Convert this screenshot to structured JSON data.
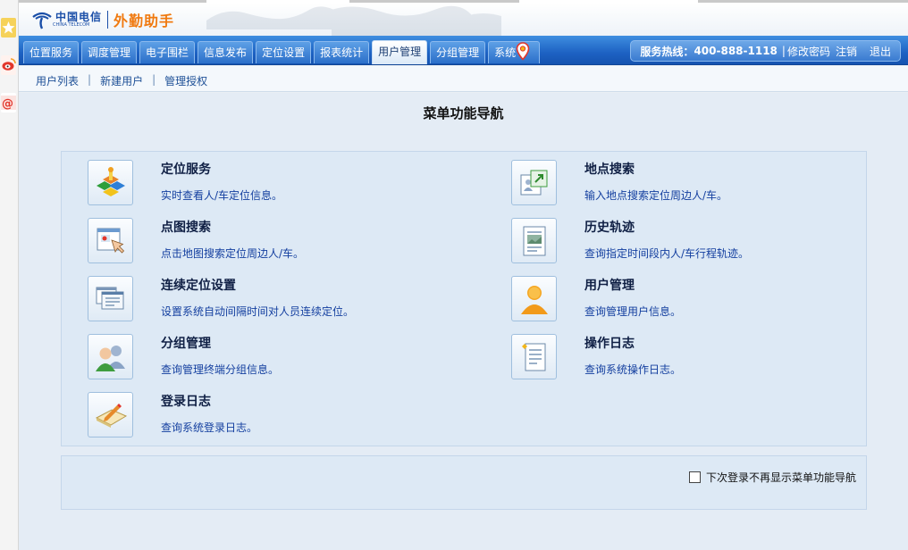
{
  "app": {
    "logo_cn": "中国电信",
    "logo_en": "CHINA TELECOM",
    "app_name": "外勤助手"
  },
  "nav": {
    "tabs": [
      {
        "label": "位置服务",
        "name": "tab-location-service"
      },
      {
        "label": "调度管理",
        "name": "tab-dispatch-management"
      },
      {
        "label": "电子围栏",
        "name": "tab-geofence"
      },
      {
        "label": "信息发布",
        "name": "tab-info-publish"
      },
      {
        "label": "定位设置",
        "name": "tab-location-settings"
      },
      {
        "label": "报表统计",
        "name": "tab-report-statistics"
      },
      {
        "label": "用户管理",
        "name": "tab-user-management",
        "active": true
      },
      {
        "label": "分组管理",
        "name": "tab-group-management"
      },
      {
        "label": "系统",
        "name": "tab-system"
      }
    ],
    "hotline_label": "服务热线：",
    "hotline_number": "400-888-1118",
    "change_password": "修改密码",
    "logout": "注销",
    "exit": "退出"
  },
  "subnav": {
    "items": [
      "用户列表",
      "新建用户",
      "管理授权"
    ],
    "separator": "|"
  },
  "page": {
    "title": "菜单功能导航"
  },
  "menu": [
    {
      "title": "定位服务",
      "desc": "实时查看人/车定位信息。",
      "icon": "location-blocks-icon"
    },
    {
      "title": "地点搜索",
      "desc": "输入地点搜索定位周边人/车。",
      "icon": "place-search-icon"
    },
    {
      "title": "点图搜索",
      "desc": "点击地图搜索定位周边人/车。",
      "icon": "map-click-icon"
    },
    {
      "title": "历史轨迹",
      "desc": "查询指定时间段内人/车行程轨迹。",
      "icon": "history-document-icon"
    },
    {
      "title": "连续定位设置",
      "desc": "设置系统自动间隔时间对人员连续定位。",
      "icon": "windows-stack-icon"
    },
    {
      "title": "用户管理",
      "desc": "查询管理用户信息。",
      "icon": "user-icon"
    },
    {
      "title": "分组管理",
      "desc": "查询管理终端分组信息。",
      "icon": "users-group-icon"
    },
    {
      "title": "操作日志",
      "desc": "查询系统操作日志。",
      "icon": "operation-log-icon"
    },
    {
      "title": "登录日志",
      "desc": "查询系统登录日志。",
      "icon": "login-log-icon"
    }
  ],
  "footer": {
    "checkbox_label": "下次登录不再显示菜单功能导航",
    "checked": false
  }
}
